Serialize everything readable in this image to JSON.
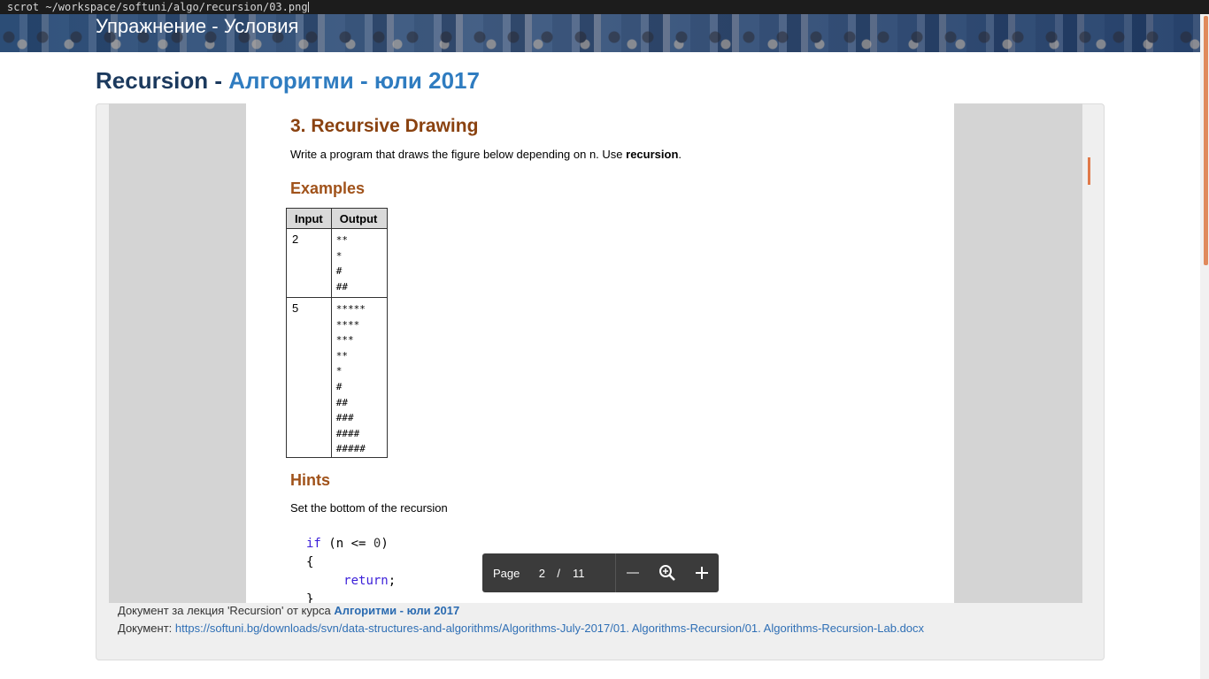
{
  "terminal": {
    "command": "scrot ~/workspace/softuni/algo/recursion/03.png"
  },
  "banner": {
    "title": "Упражнение - Условия"
  },
  "heading": {
    "lecture": "Recursion",
    "separator": " - ",
    "course": "Алгоритми - юли 2017"
  },
  "document": {
    "title": "3. Recursive Drawing",
    "intro_prefix": "Write a program that draws the figure below depending on n. Use ",
    "intro_bold": "recursion",
    "intro_suffix": ".",
    "examples_heading": "Examples",
    "table": {
      "headers": [
        "Input",
        "Output"
      ],
      "rows": [
        {
          "input": "2",
          "output": [
            "**",
            "*",
            "#",
            "##"
          ]
        },
        {
          "input": "5",
          "output": [
            "*****",
            "****",
            "***",
            "**",
            "*",
            "#",
            "##",
            "###",
            "####",
            "#####"
          ]
        }
      ]
    },
    "hints_heading": "Hints",
    "hint_text": "Set the bottom of the recursion",
    "code": {
      "kw_if": "if",
      "cond": " (n <= ",
      "zero": "0",
      "close": ")",
      "open_brace": "{",
      "kw_return": "return",
      "semi": ";",
      "close_brace": "}"
    }
  },
  "toolbar": {
    "page_label": "Page",
    "current_page": "2",
    "separator": "/",
    "total_pages": "11"
  },
  "caption": {
    "line1_prefix": "Документ за лекция 'Recursion' от курса ",
    "line1_course": "Алгоритми - юли 2017",
    "line2_prefix": "Документ: ",
    "line2_link": "https://softuni.bg/downloads/svn/data-structures-and-algorithms/Algorithms-July-2017/01. Algorithms-Recursion/01. Algorithms-Recursion-Lab.docx"
  },
  "colors": {
    "accent": "#2f7cc0",
    "heading_dark": "#1c3a5e",
    "doc_heading": "#8a4210",
    "scroll_accent": "#e08a5c"
  }
}
